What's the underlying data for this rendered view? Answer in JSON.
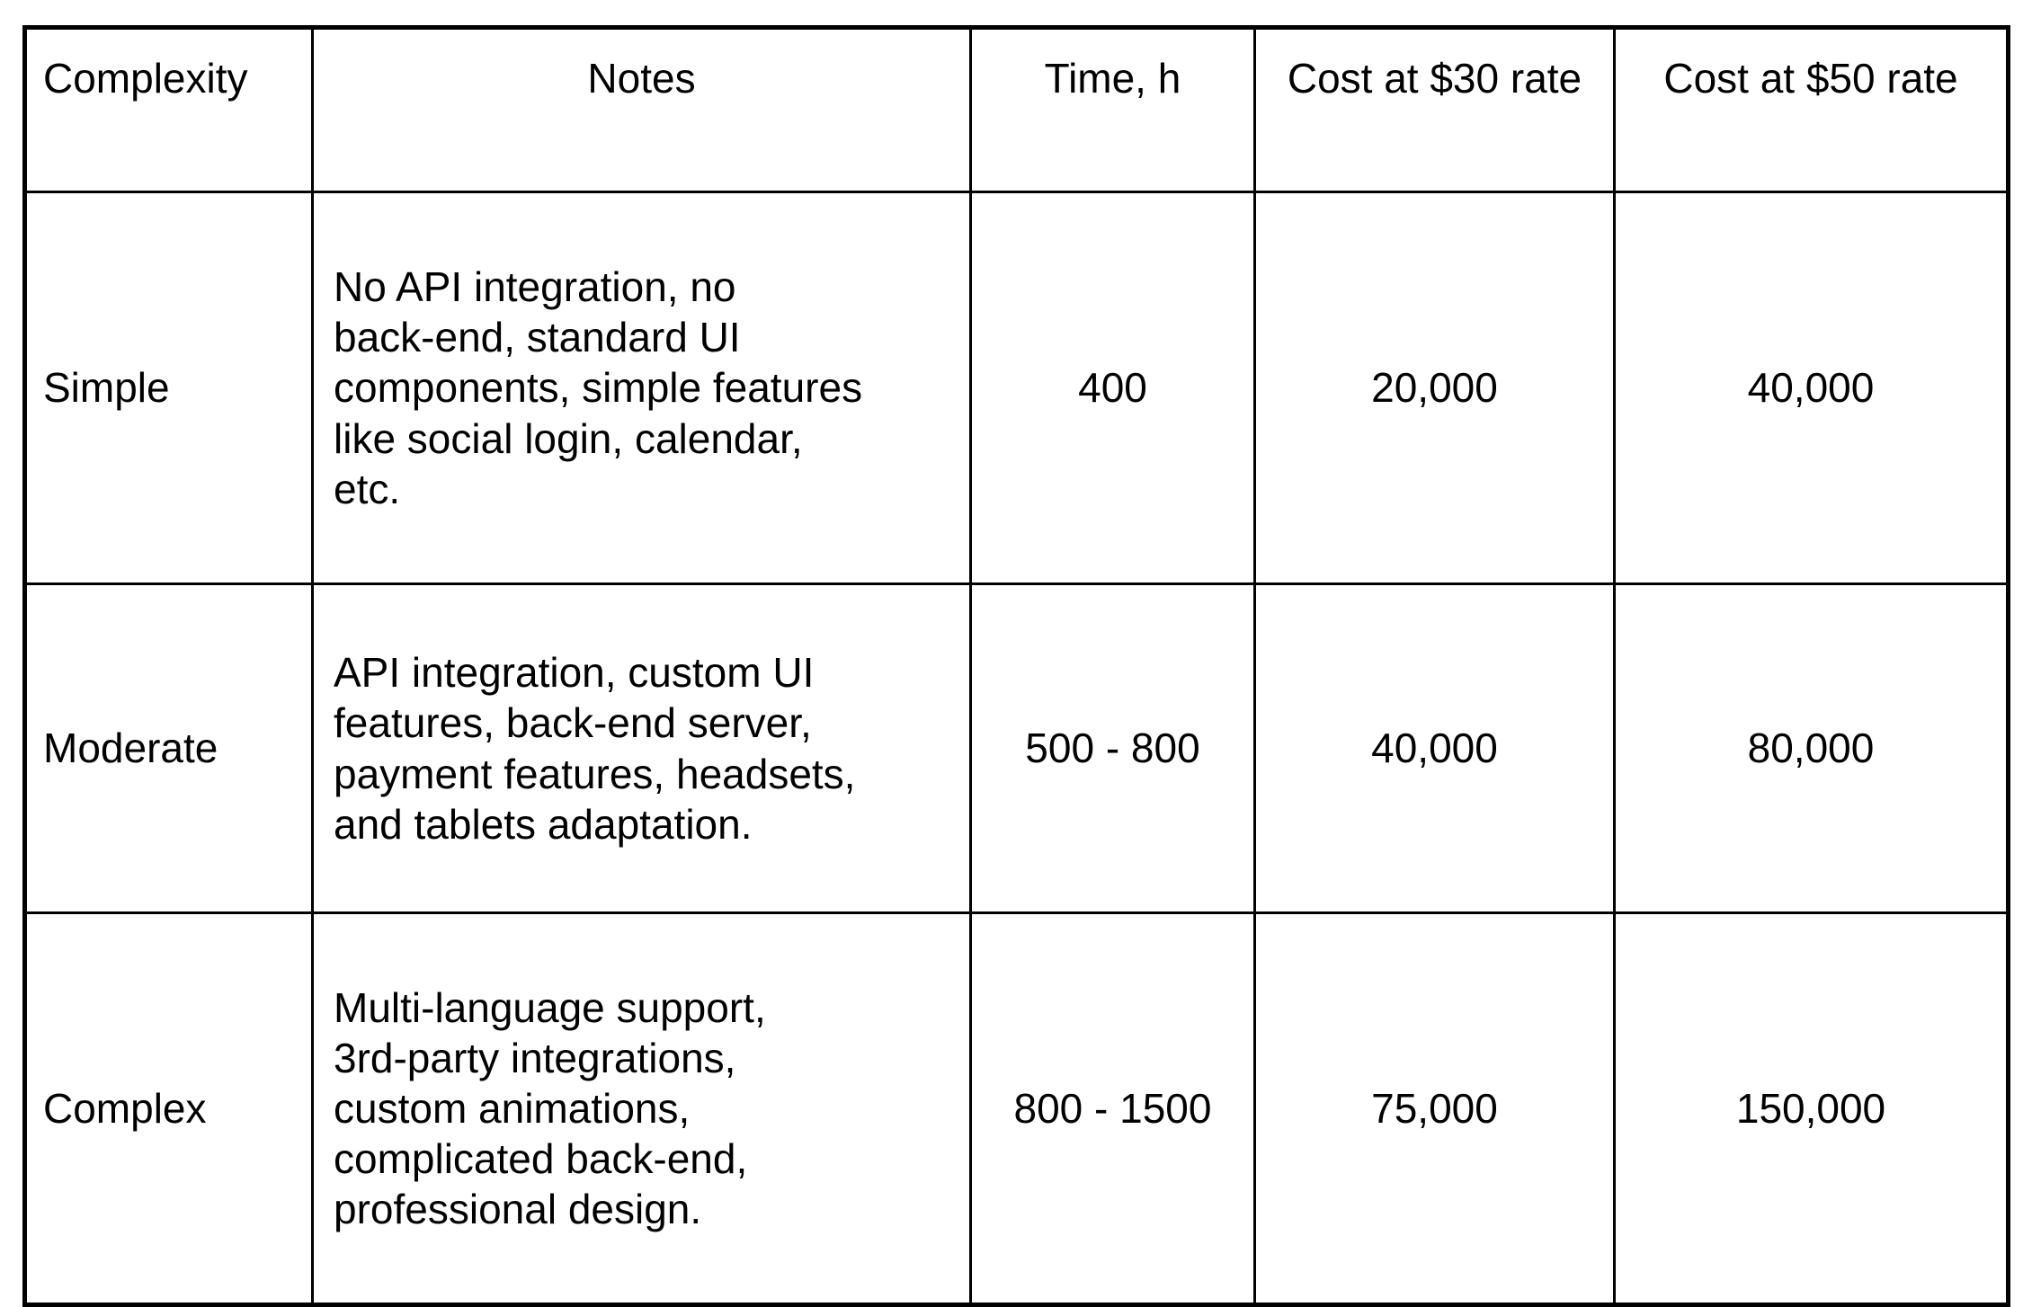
{
  "table": {
    "columns": [
      {
        "key": "complexity",
        "label": "Complexity",
        "align": "center"
      },
      {
        "key": "notes",
        "label": "Notes",
        "align": "center"
      },
      {
        "key": "time",
        "label": "Time, h",
        "align": "center"
      },
      {
        "key": "cost30",
        "label": "Cost at $30 rate",
        "align": "center"
      },
      {
        "key": "cost50",
        "label": "Cost at $50 rate",
        "align": "center"
      }
    ],
    "rows": [
      {
        "complexity": "Simple",
        "notes": "No API integration, no back-end, standard UI components, simple features like social login, calendar, etc.",
        "notes_lines": [
          "No API integration, no",
          "back-end, standard UI",
          "components, simple features",
          "like social login, calendar,",
          "etc."
        ],
        "time": "400",
        "cost30": "20,000",
        "cost50": "40,000"
      },
      {
        "complexity": "Moderate",
        "notes": "API integration, custom UI features, back-end server, payment features, headsets, and tablets adaptation.",
        "notes_lines": [
          "API integration, custom UI",
          "features, back-end server,",
          "payment features, headsets,",
          "and tablets adaptation."
        ],
        "time": "500 - 800",
        "cost30": "40,000",
        "cost50": "80,000"
      },
      {
        "complexity": "Complex",
        "notes": "Multi-language support, 3rd-party integrations, custom animations, complicated back-end, professional design.",
        "notes_lines": [
          "Multi-language support,",
          "3rd-party integrations,",
          "custom animations,",
          "complicated back-end,",
          "professional design."
        ],
        "time": "800 - 1500",
        "cost30": "75,000",
        "cost50": "150,000"
      }
    ]
  },
  "colors": {
    "border": "#000000",
    "text": "#000000",
    "background": "#ffffff"
  }
}
